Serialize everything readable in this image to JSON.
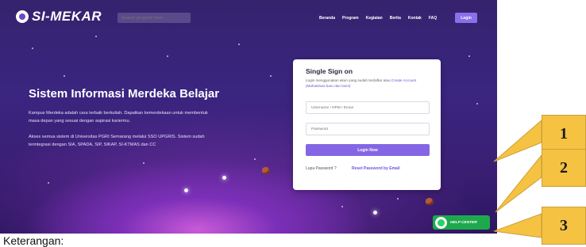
{
  "navbar": {
    "logo_text": "SI-MEKAR",
    "search_placeholder": "Search program here...",
    "links": [
      "Beranda",
      "Program",
      "Kegiatan",
      "Berita",
      "Kontak",
      "FAQ"
    ],
    "login_label": "Login"
  },
  "hero": {
    "title": "Sistem Informasi Merdeka Belajar",
    "paragraph1": "Kampus Merdeka adalah cara terbaik berkuliah. Dapatkan kemerdekaan untuk membentuk masa depan yang sesuai dengan aspirasi kariermu.",
    "paragraph2": "Akses semua sistem di Universitas PGRI Semarang melalui SSO UPGRIS. Sistem sudah terintegrasi dengan SIA, SPADA, SIP, SIKAP, SI-KTMAS dan CC"
  },
  "sso_card": {
    "title": "Single Sign on",
    "description": "Login menggunakan akun yang sudah terdaftar atau",
    "description_link": "Create Account (Mahasiswa baru dan lain2)",
    "username_placeholder": "Username / NPM / Email",
    "password_placeholder": "Password",
    "submit_label": "Login Now",
    "forgot_label": "Lupa Password ?",
    "reset_label": "Reset Password by Email"
  },
  "help_center": {
    "label": "HELP CENTER",
    "icon": "whatsapp-icon",
    "color": "#1ea84e"
  },
  "callouts": [
    "1",
    "2",
    "3"
  ],
  "caption": "Keterangan:",
  "colors": {
    "background": "#3a2580",
    "accent": "#8466e4",
    "callout": "#f5c242"
  }
}
